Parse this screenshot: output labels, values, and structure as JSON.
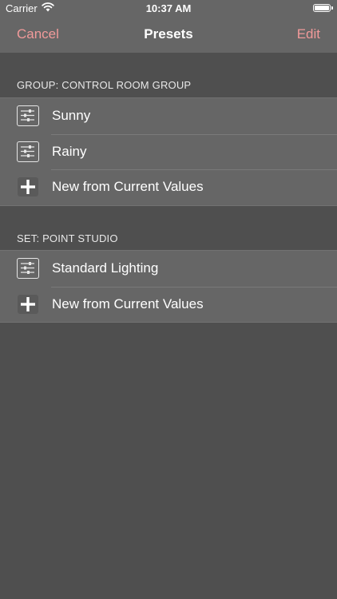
{
  "status_bar": {
    "carrier": "Carrier",
    "time": "10:37 AM",
    "wifi_icon": "wifi-icon",
    "battery_icon": "battery-icon"
  },
  "nav": {
    "cancel_label": "Cancel",
    "title": "Presets",
    "edit_label": "Edit"
  },
  "colors": {
    "accent": "#f19a9a",
    "background": "#4f4f4f",
    "cell_background": "#666666"
  },
  "sections": [
    {
      "header": "GROUP: CONTROL ROOM GROUP",
      "items": [
        {
          "label": "Sunny",
          "icon": "sliders-icon"
        },
        {
          "label": "Rainy",
          "icon": "sliders-icon"
        },
        {
          "label": "New from Current Values",
          "icon": "plus-icon"
        }
      ]
    },
    {
      "header": "SET: POINT STUDIO",
      "items": [
        {
          "label": "Standard Lighting",
          "icon": "sliders-icon"
        },
        {
          "label": "New from Current Values",
          "icon": "plus-icon"
        }
      ]
    }
  ]
}
